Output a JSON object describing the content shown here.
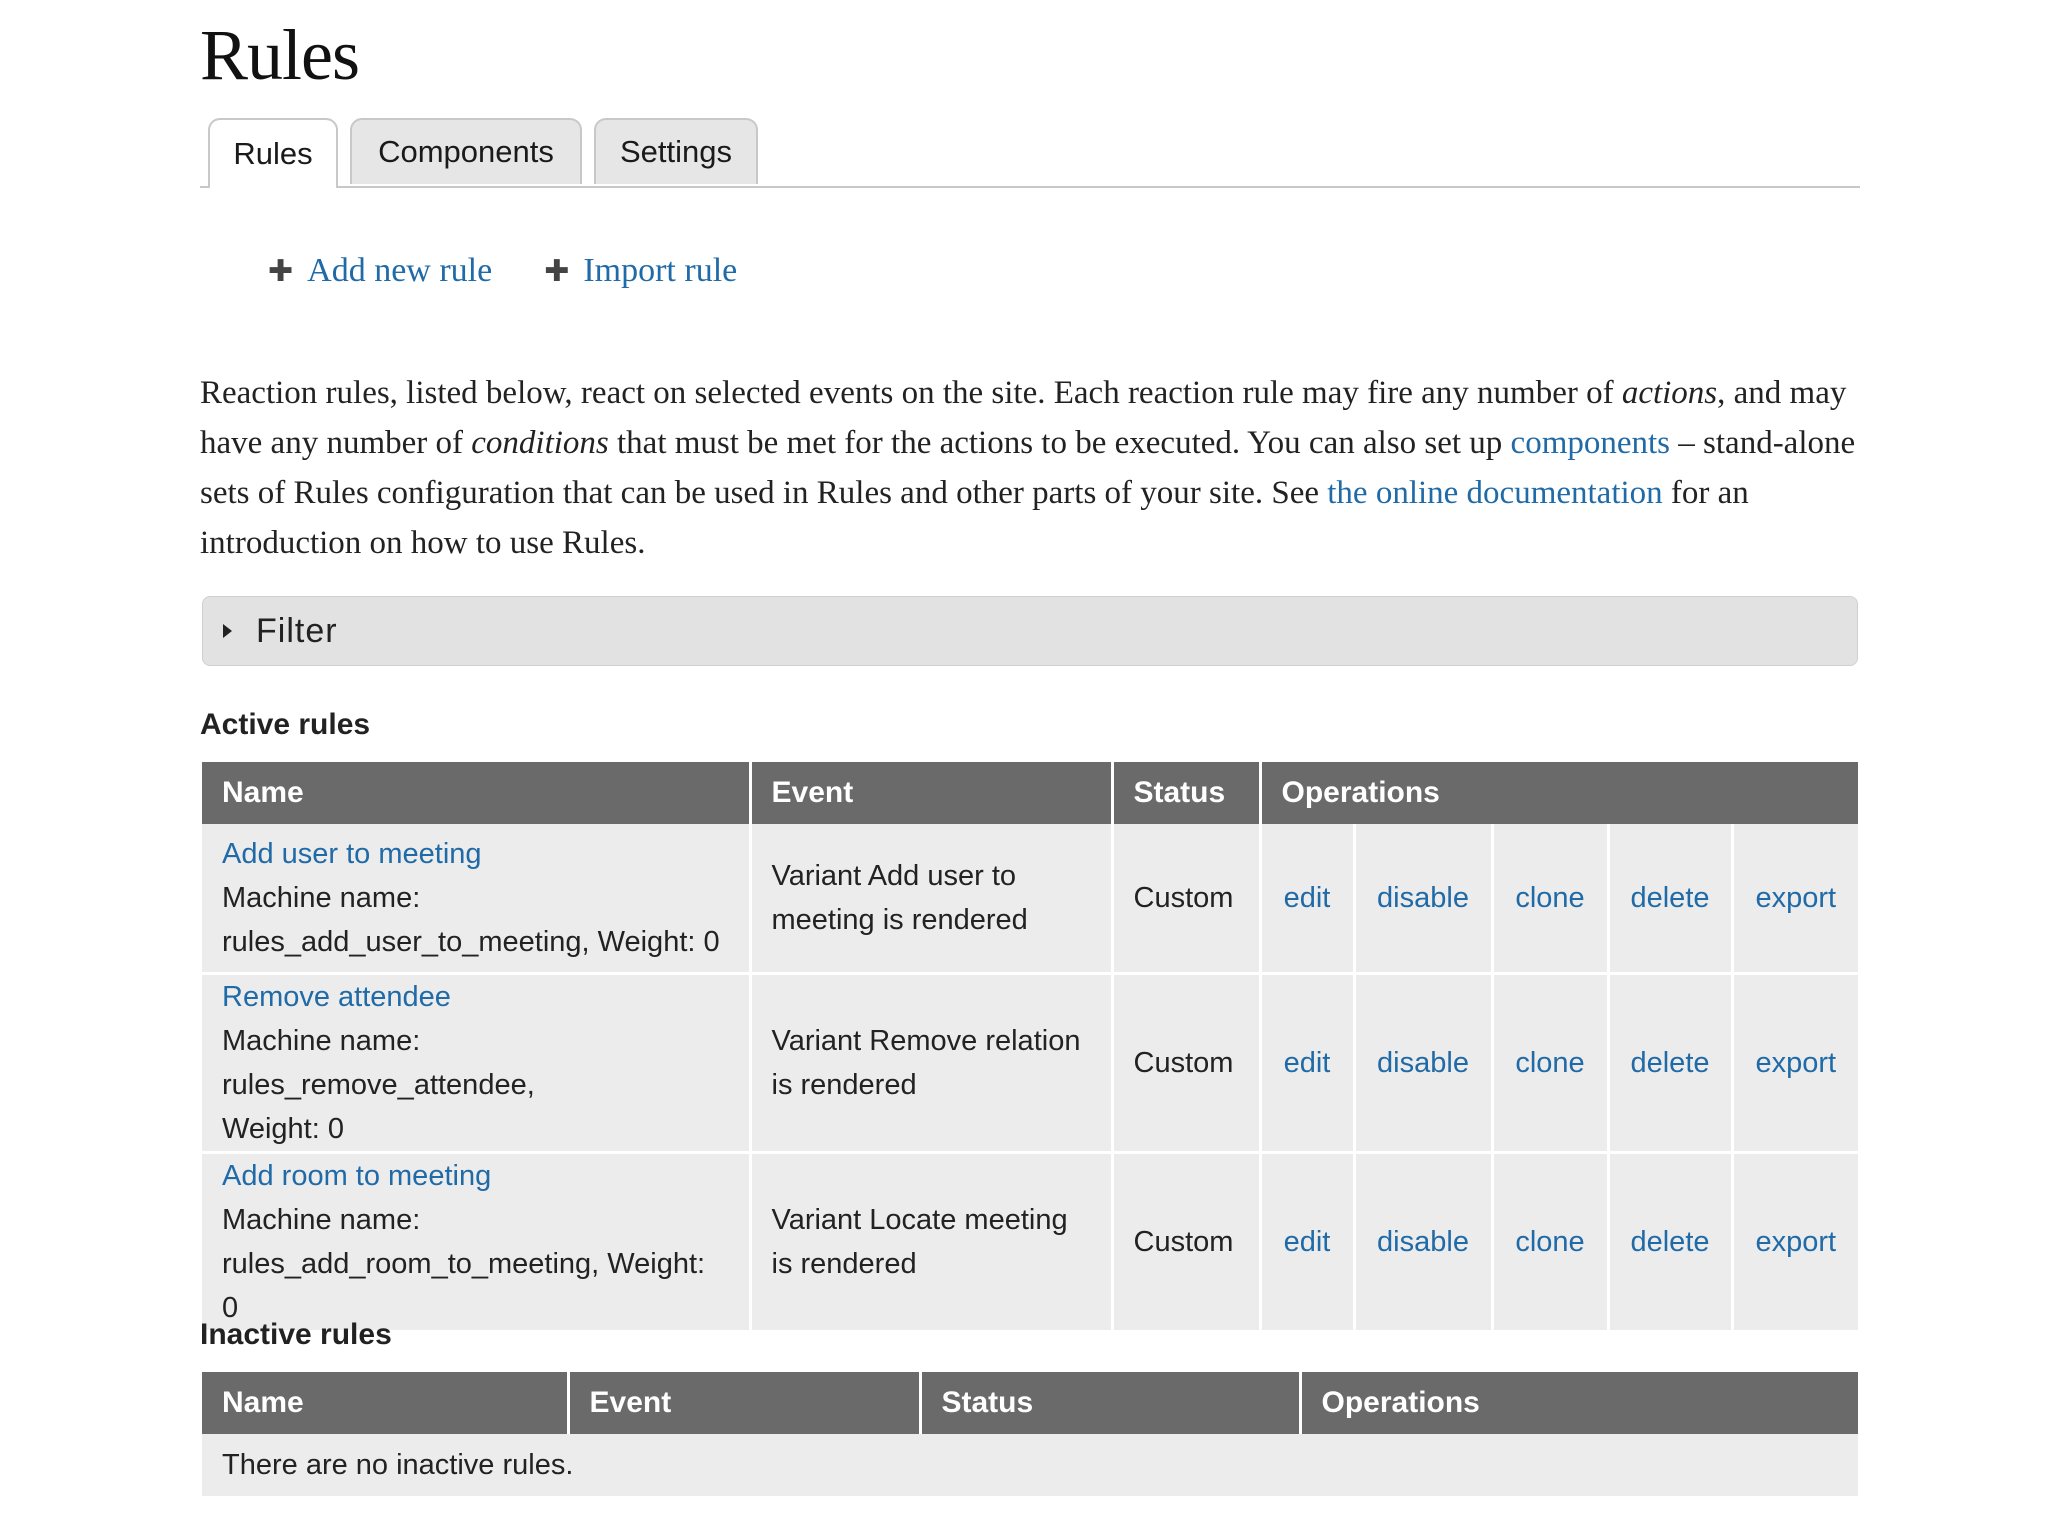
{
  "page": {
    "title": "Rules"
  },
  "tabs": [
    {
      "label": "Rules",
      "active": true
    },
    {
      "label": "Components",
      "active": false
    },
    {
      "label": "Settings",
      "active": false
    }
  ],
  "actions": {
    "add_new_rule": "Add new rule",
    "import_rule": "Import rule"
  },
  "intro": {
    "part1": "Reaction rules, listed below, react on selected events on the site. Each reaction rule may fire any number of ",
    "actions_word": "actions",
    "part2": ", and may have any number of ",
    "conditions_word": "conditions",
    "part3": " that must be met for the actions to be executed. You can also set up ",
    "components_link": "components",
    "part4": " – stand-alone sets of Rules configuration that can be used in Rules and other parts of your site. See ",
    "docs_link": "the online documentation",
    "part5": " for an introduction on how to use Rules."
  },
  "filter": {
    "label": "Filter"
  },
  "active_rules": {
    "title": "Active rules",
    "headers": {
      "name": "Name",
      "event": "Event",
      "status": "Status",
      "operations": "Operations"
    },
    "rows": [
      {
        "name": "Add user to meeting",
        "machine_line1": "Machine name:",
        "machine_line2": "rules_add_user_to_meeting, Weight: 0",
        "event": "Variant Add user to meeting is rendered",
        "status": "Custom"
      },
      {
        "name": "Remove attendee",
        "machine_line1": "Machine name: rules_remove_attendee,",
        "machine_line2": "Weight: 0",
        "event": "Variant Remove relation is rendered",
        "status": "Custom"
      },
      {
        "name": "Add room to meeting",
        "machine_line1": "Machine name:",
        "machine_line2": "rules_add_room_to_meeting, Weight: 0",
        "event": "Variant Locate meeting is rendered",
        "status": "Custom"
      }
    ],
    "operations": {
      "edit": "edit",
      "disable": "disable",
      "clone": "clone",
      "delete": "delete",
      "export": "export"
    }
  },
  "inactive_rules": {
    "title": "Inactive rules",
    "headers": {
      "name": "Name",
      "event": "Event",
      "status": "Status",
      "operations": "Operations"
    },
    "empty_message": "There are no inactive rules."
  },
  "colors": {
    "link": "#1f6aa7",
    "table_header": "#6a6a6a",
    "table_row": "#ececec",
    "filter_bg": "#e2e2e2"
  }
}
